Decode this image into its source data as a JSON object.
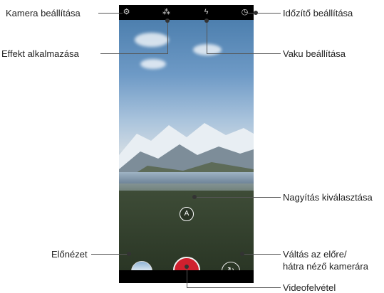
{
  "screen": {
    "top_icons": {
      "settings": "⚙",
      "effect": "⁂",
      "flash": "ϟ",
      "timer": "◷"
    },
    "zoom_symbol": "A",
    "switch_symbol": "↻"
  },
  "callouts": {
    "camera_settings": "Kamera beállítása",
    "apply_effect": "Effekt alkalmazása",
    "timer_settings": "Időzítő beállítása",
    "flash_settings": "Vaku beállítása",
    "zoom_select": "Nagyítás kiválasztása",
    "preview": "Előnézet",
    "switch_camera_line1": "Váltás az elő​re/",
    "switch_camera_line2": "hátra néző kamerára",
    "video_record": "Videofelvétel"
  }
}
